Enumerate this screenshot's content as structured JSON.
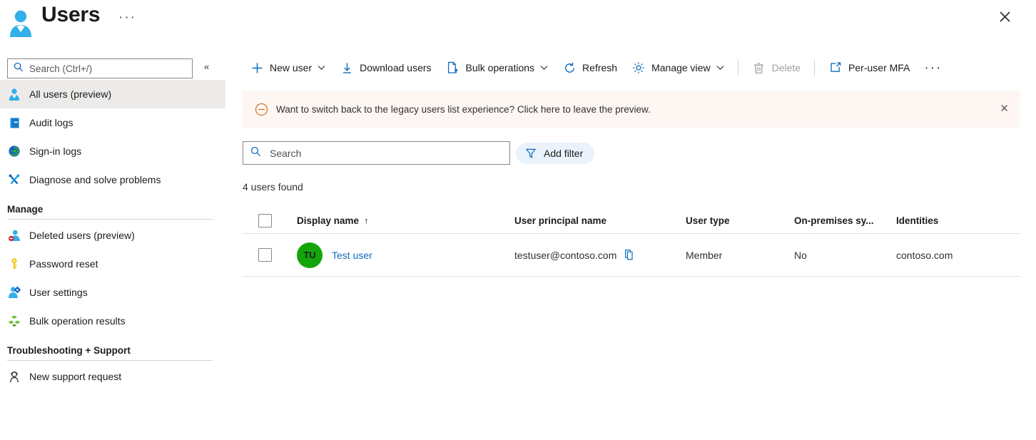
{
  "header": {
    "title": "Users",
    "icon": "user-large-icon",
    "ellipsis": "···",
    "close_label": "✕"
  },
  "sidebar": {
    "search_placeholder": "Search (Ctrl+/)",
    "search_value": "",
    "collapse_label": "«",
    "items": [
      {
        "label": "All users (preview)",
        "icon": "user-icon",
        "selected": true
      },
      {
        "label": "Audit logs",
        "icon": "book-icon",
        "selected": false
      },
      {
        "label": "Sign-in logs",
        "icon": "signin-arrow-icon",
        "selected": false
      },
      {
        "label": "Diagnose and solve problems",
        "icon": "wrench-screwdriver-icon",
        "selected": false
      }
    ],
    "groups": [
      {
        "title": "Manage",
        "items": [
          {
            "label": "Deleted users (preview)",
            "icon": "user-deleted-icon"
          },
          {
            "label": "Password reset",
            "icon": "key-icon"
          },
          {
            "label": "User settings",
            "icon": "user-gear-icon"
          },
          {
            "label": "Bulk operation results",
            "icon": "cubes-icon"
          }
        ]
      },
      {
        "title": "Troubleshooting + Support",
        "items": [
          {
            "label": "New support request",
            "icon": "support-person-icon"
          }
        ]
      }
    ]
  },
  "toolbar": {
    "items": [
      {
        "label": "New user",
        "icon": "plus-icon",
        "caret": true,
        "disabled": false
      },
      {
        "label": "Download users",
        "icon": "download-icon",
        "caret": false,
        "disabled": false
      },
      {
        "label": "Bulk operations",
        "icon": "bulk-page-icon",
        "caret": true,
        "disabled": false
      },
      {
        "label": "Refresh",
        "icon": "refresh-icon",
        "caret": false,
        "disabled": false
      },
      {
        "label": "Manage view",
        "icon": "gear-icon",
        "caret": true,
        "disabled": false
      },
      {
        "label": "Delete",
        "icon": "trash-icon",
        "caret": false,
        "disabled": true
      },
      {
        "label": "Per-user MFA",
        "icon": "external-link-icon",
        "caret": false,
        "disabled": false
      }
    ],
    "more_label": "···"
  },
  "banner": {
    "icon": "blocked-circle-icon",
    "text": "Want to switch back to the legacy users list experience? Click here to leave the preview.",
    "close_label": "✕",
    "background": "#fdf6f3",
    "icon_color": "#d1762b"
  },
  "filters": {
    "search_placeholder": "Search",
    "search_value": "",
    "add_filter_label": "Add filter",
    "filter_icon": "funnel-icon"
  },
  "results": {
    "count_text": "4 users found"
  },
  "table": {
    "columns": [
      "Display name",
      "User principal name",
      "User type",
      "On-premises sy...",
      "Identities"
    ],
    "sort_indicator": "↑",
    "rows": [
      {
        "initials": "TU",
        "avatar_color": "#14a50b",
        "display_name": "Test user",
        "user_principal_name": "testuser@contoso.com",
        "copy_icon": "copy-icon",
        "user_type": "Member",
        "on_premises_sync": "No",
        "identities": "contoso.com"
      }
    ]
  },
  "colors": {
    "accent": "#0f6cbd",
    "azure_blue": "#0078d4",
    "selected_row": "#edebe9"
  }
}
